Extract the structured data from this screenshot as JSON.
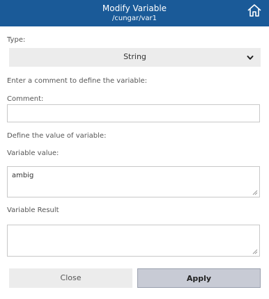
{
  "header": {
    "title": "Modify Variable",
    "subtitle": "/cungar/var1",
    "home_icon": "home-icon"
  },
  "form": {
    "type_label": "Type:",
    "type_value": "String",
    "comment_hint": "Enter a comment to define the variable:",
    "comment_label": "Comment:",
    "comment_value": "",
    "value_hint": "Define the value of variable:",
    "value_label": "Variable value:",
    "value_value": "ambig",
    "result_label": "Variable Result",
    "result_value": ""
  },
  "buttons": {
    "close": "Close",
    "apply": "Apply"
  },
  "colors": {
    "header_bg": "#1a5a98",
    "apply_bg": "#c8cbd5"
  }
}
